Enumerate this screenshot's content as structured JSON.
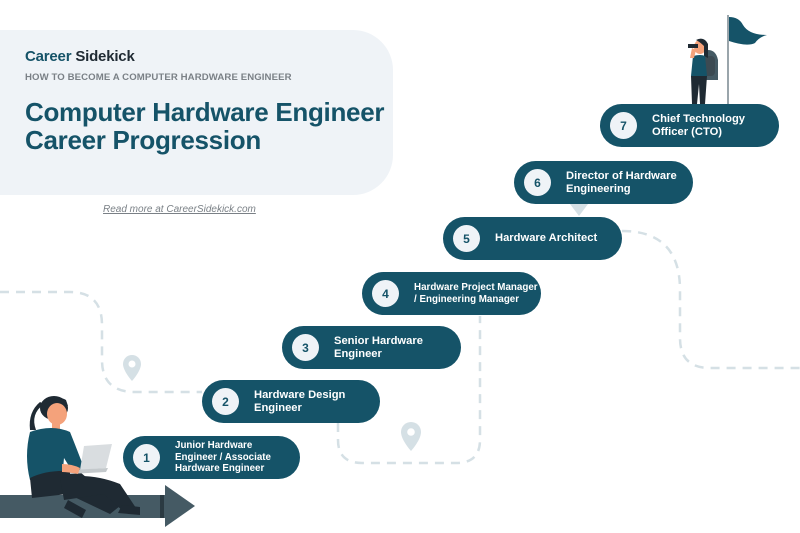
{
  "brand": {
    "part1": "Career",
    "part2": "Sidekick"
  },
  "kicker": "HOW TO BECOME A COMPUTER HARDWARE ENGINEER",
  "title": "Computer Hardware Engineer Career Progression",
  "read_more": "Read more at CareerSidekick.com",
  "colors": {
    "primary": "#155368",
    "card_bg": "#eff3f7",
    "path": "#d5e0e5",
    "arrow": "#455a64"
  },
  "icons": [
    "map-pin-icon",
    "map-pin-icon",
    "flag-icon",
    "person-laptop-illustration",
    "person-binoculars-illustration",
    "arrow-right-icon"
  ],
  "steps": [
    {
      "number": "1",
      "label": "Junior Hardware Engineer / Associate Hardware Engineer"
    },
    {
      "number": "2",
      "label": "Hardware Design Engineer"
    },
    {
      "number": "3",
      "label": "Senior Hardware Engineer"
    },
    {
      "number": "4",
      "label": "Hardware Project Manager / Engineering Manager"
    },
    {
      "number": "5",
      "label": "Hardware Architect"
    },
    {
      "number": "6",
      "label": "Director of Hardware Engineering"
    },
    {
      "number": "7",
      "label": "Chief Technology Officer (CTO)"
    }
  ]
}
